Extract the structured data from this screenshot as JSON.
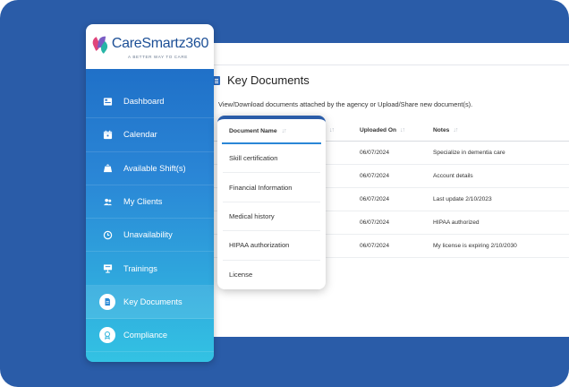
{
  "logo": {
    "brand": "CareSmartz360",
    "tagline": "A BETTER WAY TO CARE"
  },
  "sidebar": {
    "items": [
      {
        "label": "Dashboard",
        "icon": "dashboard-icon"
      },
      {
        "label": "Calendar",
        "icon": "calendar-icon"
      },
      {
        "label": "Available Shift(s)",
        "icon": "shift-bag-icon"
      },
      {
        "label": "My Clients",
        "icon": "clients-icon"
      },
      {
        "label": "Unavailability",
        "icon": "clock-icon"
      },
      {
        "label": "Trainings",
        "icon": "training-icon"
      },
      {
        "label": "Key Documents",
        "icon": "document-icon",
        "active": true
      },
      {
        "label": "Compliance",
        "icon": "compliance-icon"
      }
    ]
  },
  "page": {
    "title": "Key Documents",
    "subtitle": "View/Download documents attached by the agency or Upload/Share new document(s)."
  },
  "table": {
    "columns": [
      "Uploaded On",
      "Notes"
    ],
    "rows": [
      {
        "uploaded_on": "06/07/2024",
        "notes": "Specialize in dementia care"
      },
      {
        "uploaded_on": "06/07/2024",
        "notes": "Account details"
      },
      {
        "uploaded_on": "06/07/2024",
        "notes": "Last update 2/10/2023"
      },
      {
        "uploaded_on": "06/07/2024",
        "notes": "HIPAA authorized"
      },
      {
        "uploaded_on": "06/07/2024",
        "notes": "My license is expiring 2/10/2030"
      }
    ]
  },
  "card": {
    "header": "Document Name",
    "rows": [
      "Skill certification",
      "Financial Information",
      "Medical history",
      "HIPAA authorization",
      "License"
    ]
  },
  "colors": {
    "frame": "#2a5ca8",
    "accent": "#2a86d6",
    "sidebar_top": "#1b67c2",
    "sidebar_bottom": "#33c2e3"
  }
}
